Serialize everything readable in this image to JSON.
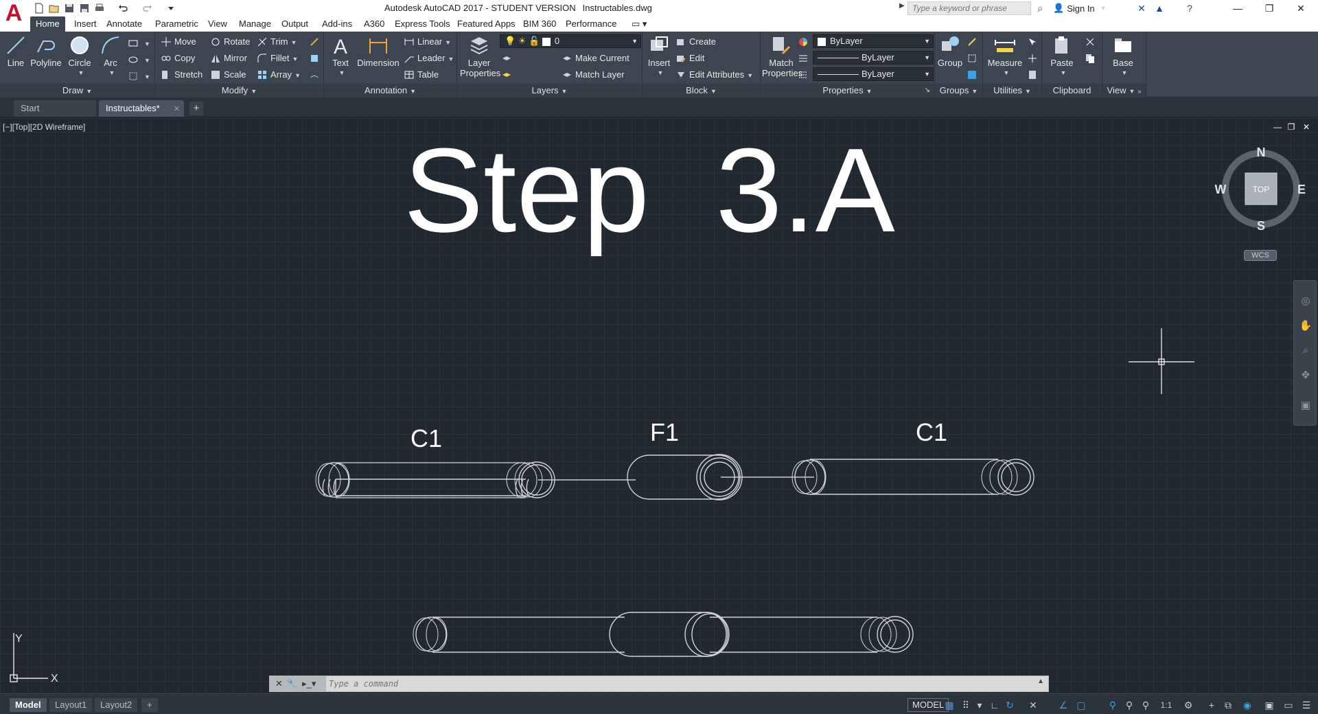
{
  "app": {
    "logo_letter": "A",
    "title": "Autodesk AutoCAD 2017 - STUDENT VERSION",
    "filename": "Instructables.dwg",
    "search_placeholder": "Type a keyword or phrase",
    "sign_in": "Sign In"
  },
  "ribbon_tabs": [
    {
      "label": "Home",
      "active": true
    },
    {
      "label": "Insert"
    },
    {
      "label": "Annotate"
    },
    {
      "label": "Parametric"
    },
    {
      "label": "View"
    },
    {
      "label": "Manage"
    },
    {
      "label": "Output"
    },
    {
      "label": "Add-ins"
    },
    {
      "label": "A360"
    },
    {
      "label": "Express Tools"
    },
    {
      "label": "Featured Apps"
    },
    {
      "label": "BIM 360"
    },
    {
      "label": "Performance"
    }
  ],
  "panels": {
    "draw": {
      "title": "Draw",
      "line": "Line",
      "polyline": "Polyline",
      "circle": "Circle",
      "arc": "Arc"
    },
    "modify": {
      "title": "Modify",
      "move": "Move",
      "rotate": "Rotate",
      "trim": "Trim",
      "copy": "Copy",
      "mirror": "Mirror",
      "fillet": "Fillet",
      "stretch": "Stretch",
      "scale": "Scale",
      "array": "Array"
    },
    "annotation": {
      "title": "Annotation",
      "text": "Text",
      "dimension": "Dimension",
      "linear": "Linear",
      "leader": "Leader",
      "table": "Table"
    },
    "layers": {
      "title": "Layers",
      "layer_properties_1": "Layer",
      "layer_properties_2": "Properties",
      "layer_value": "0",
      "make_current": "Make Current",
      "match_layer": "Match Layer"
    },
    "block": {
      "title": "Block",
      "insert": "Insert",
      "create": "Create",
      "edit": "Edit",
      "edit_attributes": "Edit Attributes"
    },
    "properties": {
      "title": "Properties",
      "match_1": "Match",
      "match_2": "Properties",
      "color": "ByLayer",
      "linetype": "ByLayer",
      "lineweight": "ByLayer"
    },
    "groups": {
      "title": "Groups",
      "group": "Group"
    },
    "utilities": {
      "title": "Utilities",
      "measure": "Measure"
    },
    "clipboard": {
      "title": "Clipboard",
      "paste": "Paste"
    },
    "view": {
      "title": "View",
      "base": "Base"
    }
  },
  "file_tabs": [
    {
      "label": "Start"
    },
    {
      "label": "Instructables*",
      "active": true
    }
  ],
  "viewport": {
    "label": "[−][Top][2D Wireframe]",
    "heading": "Step  3.A",
    "labels": [
      "C1",
      "F1",
      "C1"
    ],
    "viewcube": {
      "n": "N",
      "s": "S",
      "e": "E",
      "w": "W",
      "face": "TOP"
    },
    "wcs": "WCS",
    "ucs_x": "X",
    "ucs_y": "Y"
  },
  "command": {
    "placeholder": "Type a command"
  },
  "layout_tabs": [
    {
      "label": "Model",
      "active": true
    },
    {
      "label": "Layout1"
    },
    {
      "label": "Layout2"
    }
  ],
  "status": {
    "model": "MODEL",
    "scale": "1:1"
  },
  "colors": {
    "accent": "#3aa0e8",
    "logo": "#c8102e",
    "ribbon": "#3d4650",
    "canvas": "#212830"
  }
}
